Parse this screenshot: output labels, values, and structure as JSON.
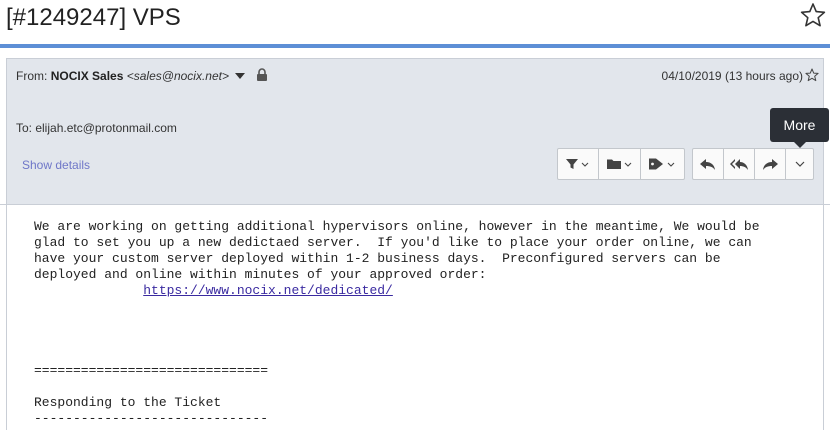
{
  "subject": "[#1249247] VPS",
  "sender": {
    "prefix": "From:",
    "name": "NOCIX Sales",
    "email": "<sales@nocix.net>"
  },
  "date": "04/10/2019 (13 hours ago)",
  "recipient": "To: elijah.etc@protonmail.com",
  "show_details": "Show details",
  "tooltip": "More",
  "icons": [
    "star-icon",
    "caret-down-icon",
    "lock-icon",
    "filter-icon",
    "folder-icon",
    "tag-icon",
    "reply-icon",
    "reply-all-icon",
    "forward-icon",
    "chevron-down-icon"
  ],
  "body": {
    "lines": [
      "We are working on getting additional hypervisors online, however in the meantime, We would be",
      "glad to set you up a new dedictaed server.  If you'd like to place your order online, we can",
      "have your custom server deployed within 1-2 business days.  Preconfigured servers can be",
      "deployed and online within minutes of your approved order:"
    ],
    "link_indent": "              ",
    "link": "https://www.nocix.net/dedicated/",
    "separator": "==============================",
    "section_title": "Responding to the Ticket",
    "dashes": "------------------------------"
  },
  "colors": {
    "accent_line": "#5d8fd6",
    "header_bg": "#e2e6ec",
    "link": "#3a2aa0",
    "show_details": "#6f77c8",
    "tooltip_bg": "#2b2f36"
  }
}
